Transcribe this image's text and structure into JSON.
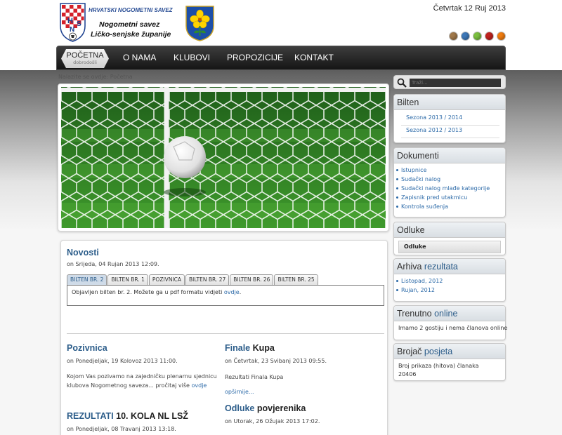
{
  "header": {
    "logo_top": "HRVATSKI NOGOMETNI SAVEZ",
    "logo_line1": "Nogometni savez",
    "logo_line2": "Ličko-senjske županije",
    "date": "Četvrtak 12 Ruj 2013",
    "style_swatches": [
      "#a0784a",
      "#3e78b8",
      "#7bbf3f",
      "#c0221f",
      "#f07c10"
    ]
  },
  "nav": {
    "home_label": "POČETNA",
    "home_sub": "dobrodošli",
    "items": [
      "O NAMA",
      "KLUBOVI",
      "PROPOZICIJE",
      "KONTAKT"
    ]
  },
  "breadcrumb": "Nalazite se ovdje: Početna",
  "novosti": {
    "title": "Novosti",
    "meta": "on Srijeda, 04 Rujan 2013 12:09.",
    "tabs": [
      "BILTEN BR. 2",
      "BILTEN BR. 1",
      "POZIVNICA",
      "BILTEN BR. 27",
      "BILTEN BR. 26",
      "BILTEN BR. 25"
    ],
    "active_tab_text": "Objavljen bilten br. 2. Možete ga u pdf formatu vidjeti",
    "active_tab_link": "ovdje",
    "active_tab_end": "."
  },
  "articles": {
    "pozivnica": {
      "title": "Pozivnica",
      "meta": "on Ponedjeljak, 19 Kolovoz 2013 11:00.",
      "text_line1": "Kojom Vas pozivamo na zajedničku plenarnu sjednicu",
      "text_line2": "klubova Nogometnog saveza... pročitaj više",
      "link": "ovdje"
    },
    "rezultati": {
      "title_accent": "REZULTATI",
      "title_rest": "10. KOLA NL LSŽ",
      "meta": "on Ponedjeljak, 08 Travanj 2013 13:18."
    },
    "finale": {
      "title_accent": "Finale",
      "title_rest": "Kupa",
      "meta": "on Četvrtak, 23 Svibanj 2013 09:55.",
      "text": "Rezultati Finala Kupa",
      "link": "opširnije..."
    },
    "odluke": {
      "title_accent": "Odluke",
      "title_rest": "povjerenika",
      "meta": "on Utorak, 26 Ožujak 2013 17:02."
    }
  },
  "search": {
    "placeholder": "Traži..."
  },
  "sidebar": {
    "bilten": {
      "title": "Bilten",
      "seasons": [
        "Sezona 2013 / 2014",
        "Sezona 2012 / 2013"
      ]
    },
    "dokumenti": {
      "title": "Dokumenti",
      "items": [
        "Istupnice",
        "Sudački nalog",
        "Sudački nalog mlađe kategorije",
        "Zapisnik pred utakmicu",
        "Kontrola suđenja"
      ]
    },
    "odluke": {
      "title": "Odluke",
      "item": "Odluke"
    },
    "arhiva": {
      "title_plain": "Arhiva",
      "title_accent": "rezultata",
      "items": [
        "Listopad, 2012",
        "Rujan, 2012"
      ]
    },
    "online": {
      "title_plain": "Trenutno",
      "title_accent": "online",
      "text": "Imamo 2 gostiju i nema članova online"
    },
    "brojac": {
      "title_plain": "Brojač",
      "title_accent": "posjeta",
      "label": "Broj prikaza (hitova) članaka",
      "value": "20406"
    }
  }
}
